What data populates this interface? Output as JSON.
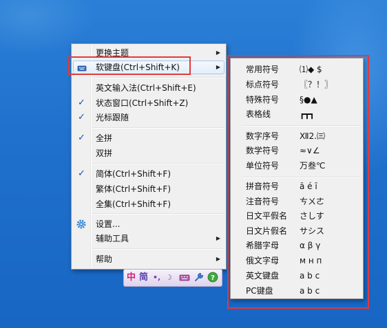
{
  "main_menu": {
    "items": [
      {
        "label": "更换主题",
        "arrow": "▶"
      },
      {
        "label": "软键盘(Ctrl+Shift+K)",
        "arrow": "▶",
        "icon": "keyboard-icon"
      },
      {
        "label": "英文输入法(Ctrl+Shift+E)"
      },
      {
        "label": "状态窗口(Ctrl+Shift+Z)",
        "check": "✓"
      },
      {
        "label": "光标跟随",
        "check": "✓"
      },
      {
        "label": "全拼",
        "check": "✓"
      },
      {
        "label": "双拼"
      },
      {
        "label": "简体(Ctrl+Shift+F)",
        "check": "✓"
      },
      {
        "label": "繁体(Ctrl+Shift+F)"
      },
      {
        "label": "全集(Ctrl+Shift+F)"
      },
      {
        "label": "设置...",
        "icon": "gear-icon"
      },
      {
        "label": "辅助工具",
        "arrow": "▶"
      },
      {
        "label": "帮助",
        "arrow": "▶"
      }
    ]
  },
  "soft_keyboard_menu": {
    "items": [
      {
        "name": "常用符号",
        "sample": "⑴◆ $"
      },
      {
        "name": "标点符号",
        "sample": "〖？！〗"
      },
      {
        "name": "特殊符号",
        "sample": "§●▲"
      },
      {
        "name": "表格线",
        "sample": "┏┳┓"
      },
      {
        "name": "数字序号",
        "sample": "Ⅻ2.㈢"
      },
      {
        "name": "数学符号",
        "sample": "≈∨∠"
      },
      {
        "name": "单位符号",
        "sample": "万叁℃"
      },
      {
        "name": "拼音符号",
        "sample": "ā é ī"
      },
      {
        "name": "注音符号",
        "sample": "ㄘㄨㄜ"
      },
      {
        "name": "日文平假名",
        "sample": "さしす"
      },
      {
        "name": "日文片假名",
        "sample": "サシス"
      },
      {
        "name": "希腊字母",
        "sample": "α β γ"
      },
      {
        "name": "俄文字母",
        "sample": "м н п"
      },
      {
        "name": "英文键盘",
        "sample": "a b c"
      },
      {
        "name": "PC键盘",
        "sample": "a b c"
      }
    ]
  },
  "ime_toolbar": {
    "mode": "中",
    "script": "简",
    "punct": "•,",
    "width": "☽"
  },
  "colors": {
    "highlight_box": "#e23a3a",
    "desktop": "#1f6fcc",
    "check": "#1a4fa8"
  }
}
